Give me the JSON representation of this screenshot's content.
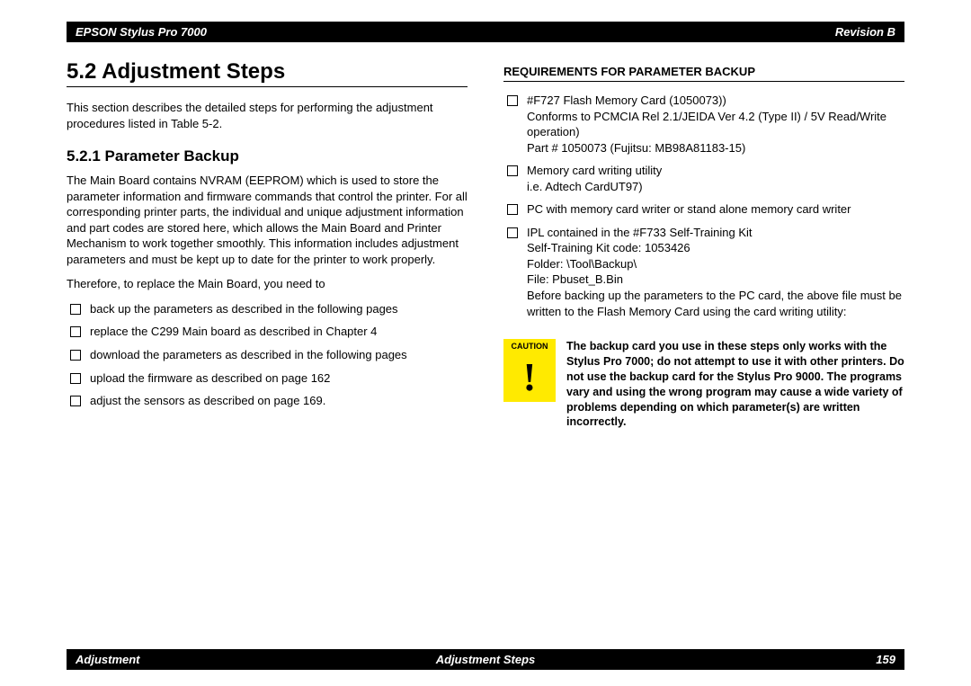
{
  "header": {
    "left": "EPSON Stylus Pro 7000",
    "right": "Revision B"
  },
  "footer": {
    "left": "Adjustment",
    "center": "Adjustment Steps",
    "right": "159"
  },
  "left": {
    "h1": "5.2  Adjustment Steps",
    "intro": "This section describes the detailed steps for performing the adjustment procedures listed in Table 5-2.",
    "h2": "5.2.1  Parameter Backup",
    "para1": "The Main Board contains NVRAM (EEPROM) which is used to store the parameter information and firmware commands that control the printer. For all corresponding printer parts, the individual and unique adjustment information and part codes are stored here, which allows the Main Board and Printer Mechanism to work together smoothly. This information includes adjustment parameters and must be kept up to date for the printer to work properly.",
    "para2": "Therefore, to replace the Main Board, you need to",
    "steps": [
      "back up the parameters as described in the following pages",
      "replace the C299 Main board as described in Chapter 4",
      "download the parameters as described in the following pages",
      "upload the firmware as described on page 162",
      "adjust the sensors as described on page 169."
    ]
  },
  "right": {
    "h3": "REQUIREMENTS FOR PARAMETER BACKUP",
    "req1_l1": "#F727 Flash Memory Card (1050073))",
    "req1_l2": "Conforms to PCMCIA Rel 2.1/JEIDA Ver 4.2 (Type II) / 5V Read/Write operation)",
    "req1_l3": "Part # 1050073 (Fujitsu: MB98A81183-15)",
    "req2_l1": "Memory card writing utility",
    "req2_l2": "i.e. Adtech CardUT97)",
    "req3": "PC with memory card writer or stand alone memory card writer",
    "req4_l1": "IPL contained in the #F733 Self-Training Kit",
    "req4_l2": "Self-Training Kit code: 1053426",
    "req4_l3": "Folder: \\Tool\\Backup\\",
    "req4_l4": "File: Pbuset_B.Bin",
    "req4_l5": "Before backing up the parameters to the PC card, the above file must be written to the Flash Memory Card using the card writing utility:",
    "caution_label": "CAUTION",
    "caution_mark": "!",
    "caution_text": "The backup card you use in these steps only works with the Stylus Pro 7000; do not attempt to use it with other printers. Do not use the backup card for the Stylus Pro 9000. The programs vary and using the wrong program may cause a wide variety of problems depending on which parameter(s) are written incorrectly."
  }
}
